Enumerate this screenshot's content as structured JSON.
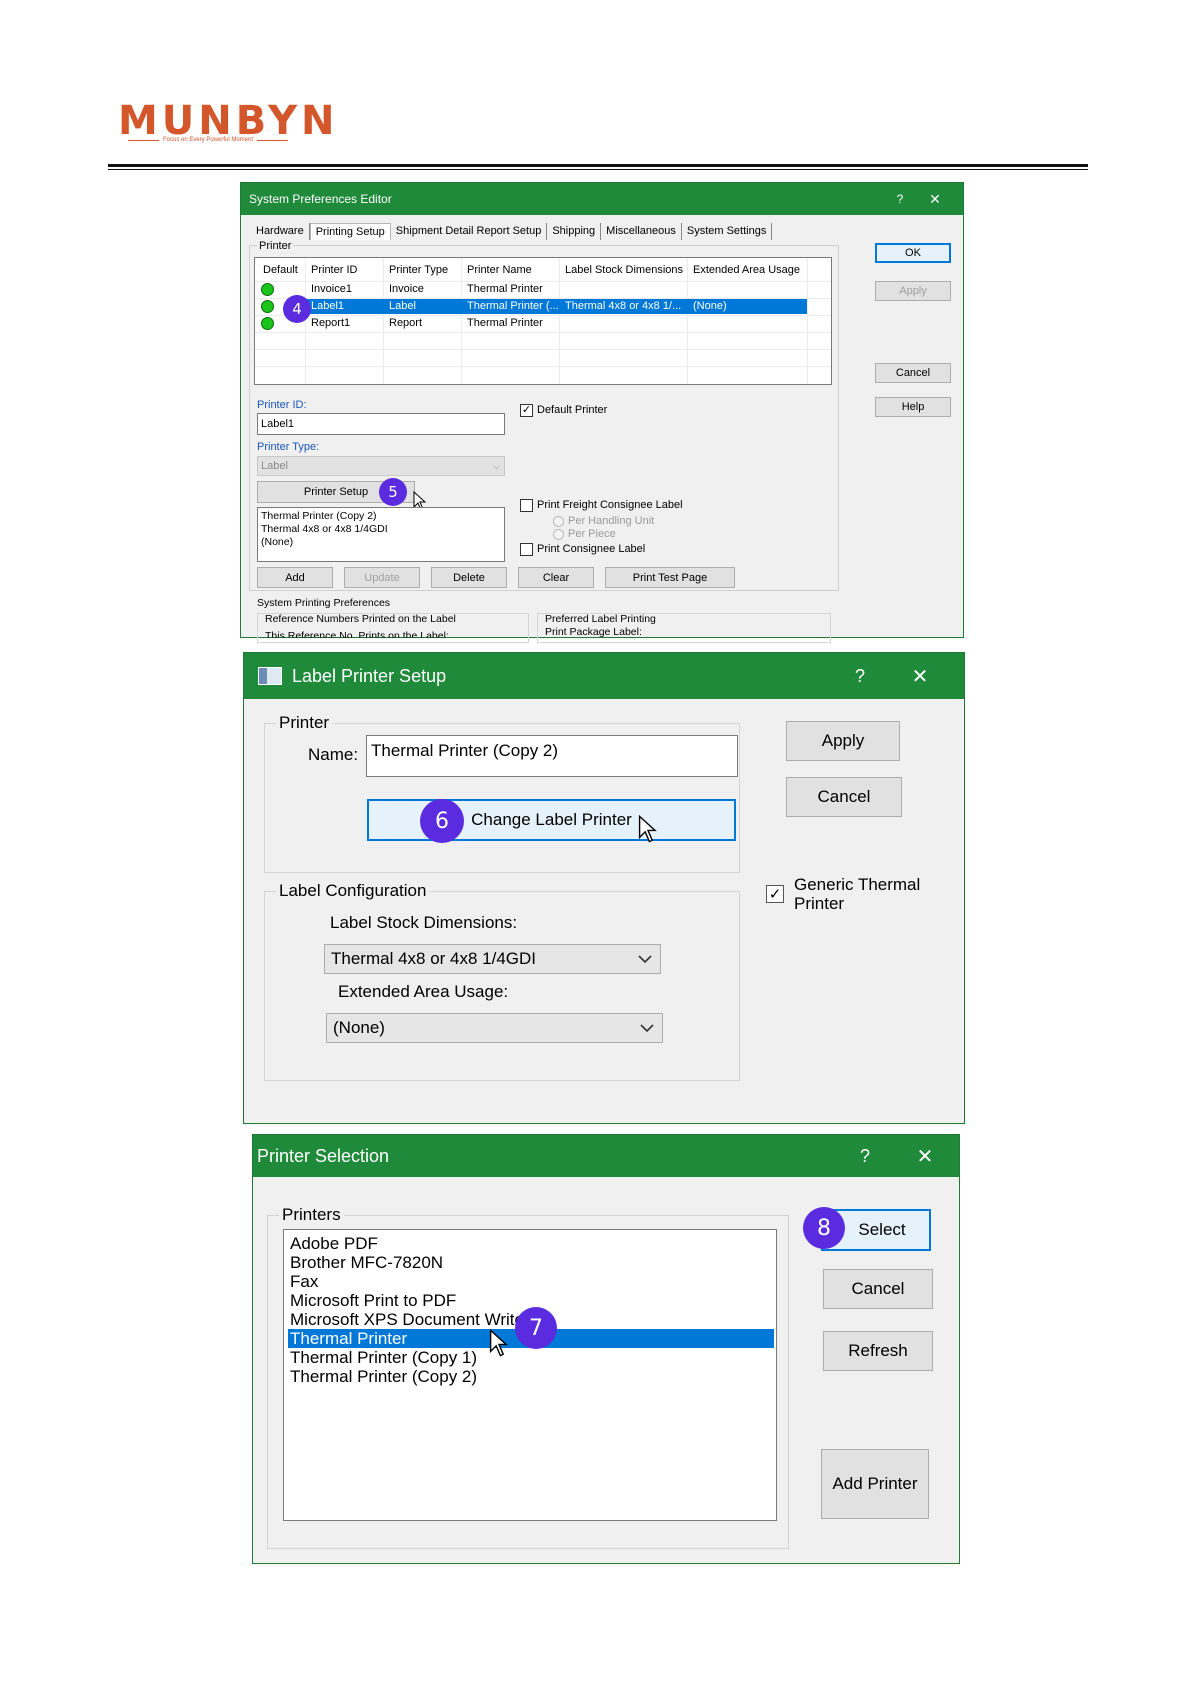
{
  "brand": {
    "logo": "MUNBYN",
    "tagline": "Focus on Every Powerful Moment"
  },
  "colors": {
    "title_bar": "#1f8a3a",
    "selection": "#0078d7",
    "marker": "#5b2be0",
    "default_dot": "#1bc41b",
    "logo": "#d4562b"
  },
  "window1": {
    "title": "System Preferences Editor",
    "help": "?",
    "close": "✕",
    "tabs": [
      "Hardware",
      "Printing Setup",
      "Shipment Detail Report Setup",
      "Shipping",
      "Miscellaneous",
      "System Settings"
    ],
    "active_tab": "Printing Setup",
    "printer_group": "Printer",
    "columns": [
      "Default",
      "Printer ID",
      "Printer Type",
      "Printer Name",
      "Label Stock Dimensions",
      "Extended Area Usage"
    ],
    "rows": [
      {
        "id": "Invoice1",
        "type": "Invoice",
        "name": "Thermal Printer",
        "stock": "",
        "extended": ""
      },
      {
        "id": "Label1",
        "type": "Label",
        "name": "Thermal Printer (...",
        "stock": "Thermal 4x8 or 4x8 1/...",
        "extended": "(None)"
      },
      {
        "id": "Report1",
        "type": "Report",
        "name": "Thermal Printer",
        "stock": "",
        "extended": ""
      }
    ],
    "printer_id_label": "Printer ID:",
    "printer_id_value": "Label1",
    "printer_type_label": "Printer Type:",
    "printer_type_value": "Label",
    "default_printer": "Default Printer",
    "printer_setup_btn": "Printer Setup",
    "info_lines": [
      "Thermal Printer (Copy 2)",
      "Thermal 4x8 or 4x8 1/4GDI",
      "(None)"
    ],
    "print_freight": "Print Freight Consignee Label",
    "per_handling": "Per Handling Unit",
    "per_piece": "Per Piece",
    "print_consignee": "Print Consignee Label",
    "buttons": {
      "add": "Add",
      "update": "Update",
      "delete": "Delete",
      "clear": "Clear",
      "test": "Print Test Page"
    },
    "side_buttons": {
      "ok": "OK",
      "apply": "Apply",
      "cancel": "Cancel",
      "help": "Help"
    },
    "system_prefs": "System Printing Preferences",
    "ref_numbers": "Reference Numbers Printed on the Label",
    "ref_cut": "This Reference No. Prints on the Label:",
    "preferred": "Preferred Label Printing",
    "package_label": "Print Package Label:",
    "markers": {
      "row": "4",
      "setup": "5"
    }
  },
  "window2": {
    "title": "Label Printer Setup",
    "help": "?",
    "close": "✕",
    "printer_group": "Printer",
    "name_label": "Name:",
    "name_value": "Thermal Printer (Copy 2)",
    "change_btn": "Change Label Printer",
    "apply_btn": "Apply",
    "cancel_btn": "Cancel",
    "generic_line1": "Generic Thermal",
    "generic_line2": "Printer",
    "label_config": "Label Configuration",
    "stock_label": "Label Stock Dimensions:",
    "stock_value": "Thermal 4x8 or 4x8 1/4GDI",
    "extended_label": "Extended Area Usage:",
    "extended_value": "(None)",
    "marker": "6"
  },
  "window3": {
    "title": "Printer Selection",
    "help": "?",
    "close": "✕",
    "printers_group": "Printers",
    "printers": [
      "Adobe PDF",
      "Brother MFC-7820N",
      "Fax",
      "Microsoft Print to PDF",
      "Microsoft XPS Document Writer",
      "Thermal Printer",
      "Thermal Printer (Copy 1)",
      "Thermal Printer (Copy 2)"
    ],
    "selected_printer": "Thermal Printer",
    "buttons": {
      "select": "Select",
      "cancel": "Cancel",
      "refresh": "Refresh",
      "add": "Add Printer"
    },
    "markers": {
      "list": "7",
      "select": "8"
    }
  }
}
